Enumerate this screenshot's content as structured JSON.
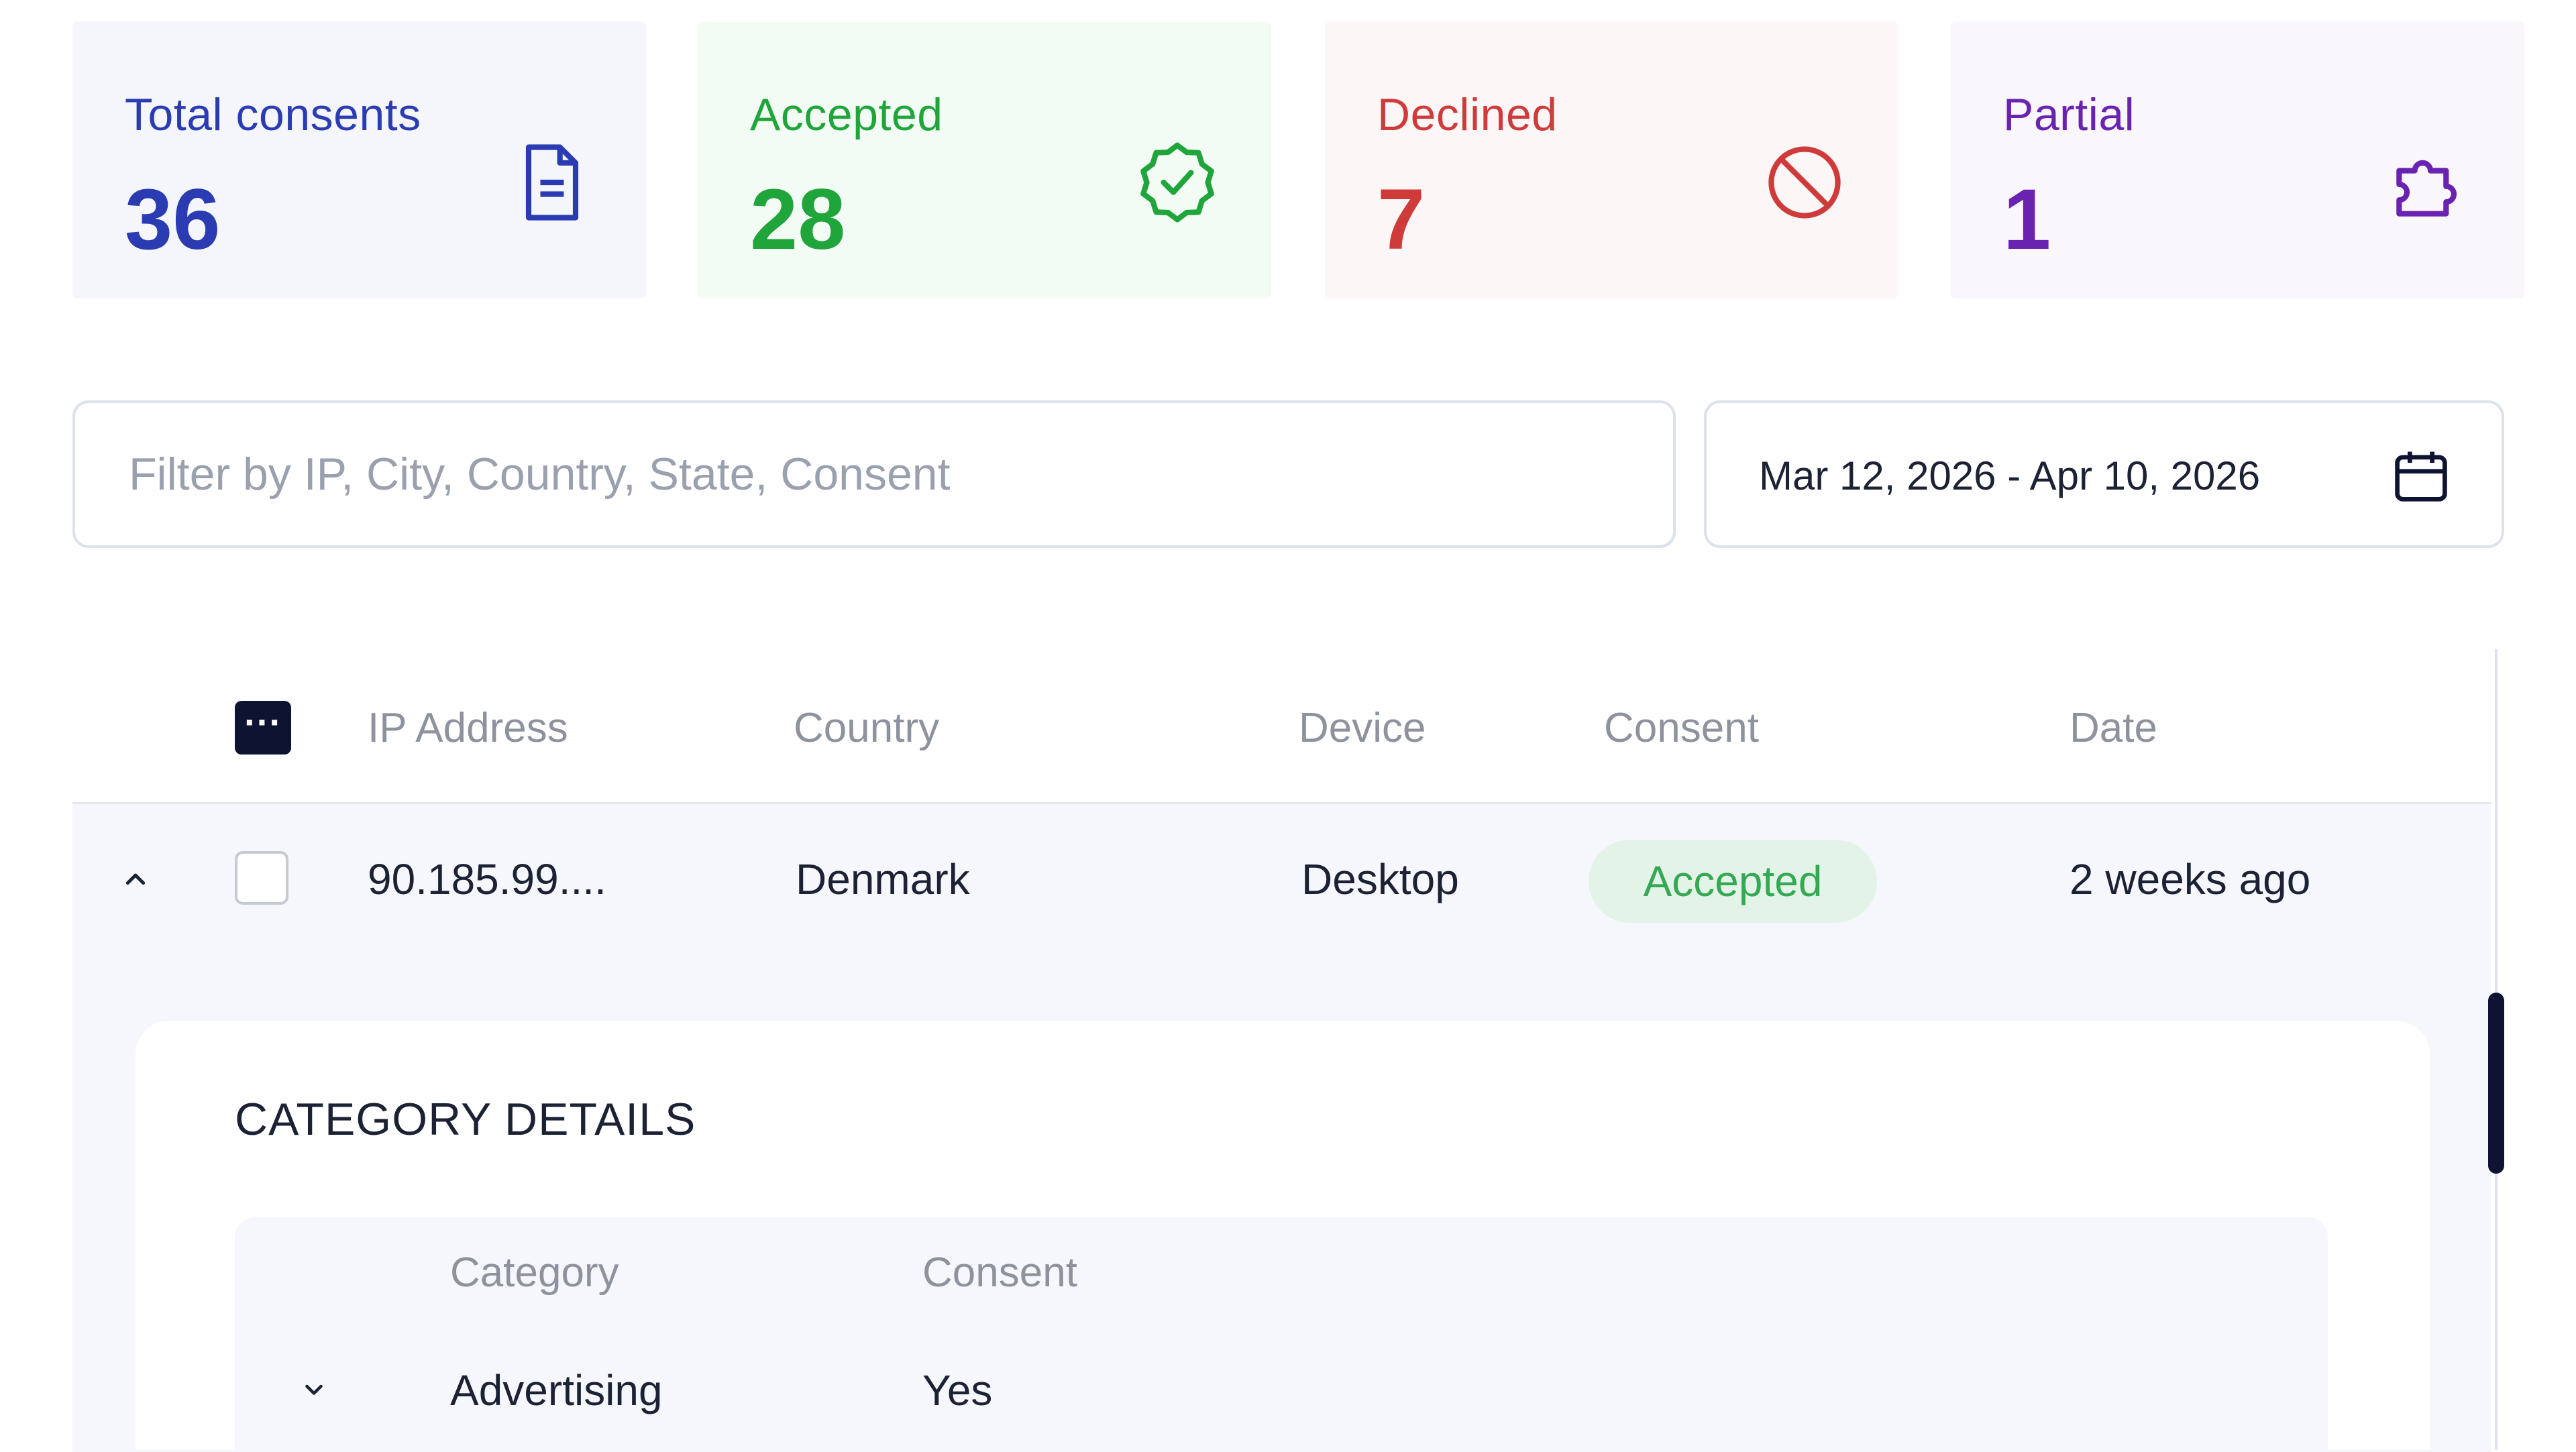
{
  "stats": [
    {
      "label": "Total consents",
      "value": "36",
      "icon": "document-icon",
      "color": "#2b3cb3",
      "bg": "#f4f6fc"
    },
    {
      "label": "Accepted",
      "value": "28",
      "icon": "verified-badge-icon",
      "color": "#1fa53a",
      "bg": "#f3fbf5"
    },
    {
      "label": "Declined",
      "value": "7",
      "icon": "block-icon",
      "color": "#cf3b3b",
      "bg": "#fcf6f6"
    },
    {
      "label": "Partial",
      "value": "1",
      "icon": "puzzle-icon",
      "color": "#6a22b0",
      "bg": "#f9f6fc"
    }
  ],
  "filter": {
    "placeholder": "Filter by IP, City, Country, State, Consent"
  },
  "date_range": {
    "text": "Mar 12, 2026 - Apr 10, 2026"
  },
  "table": {
    "select_all_label": "···",
    "headers": [
      "IP Address",
      "Country",
      "Device",
      "Consent",
      "Date"
    ],
    "rows": [
      {
        "ip": "90.185.99....",
        "country": "Denmark",
        "device": "Desktop",
        "consent": "Accepted",
        "date": "2 weeks ago"
      }
    ]
  },
  "details": {
    "title": "CATEGORY DETAILS",
    "headers": [
      "Category",
      "Consent"
    ],
    "rows": [
      {
        "category": "Advertising",
        "consent": "Yes"
      }
    ]
  }
}
